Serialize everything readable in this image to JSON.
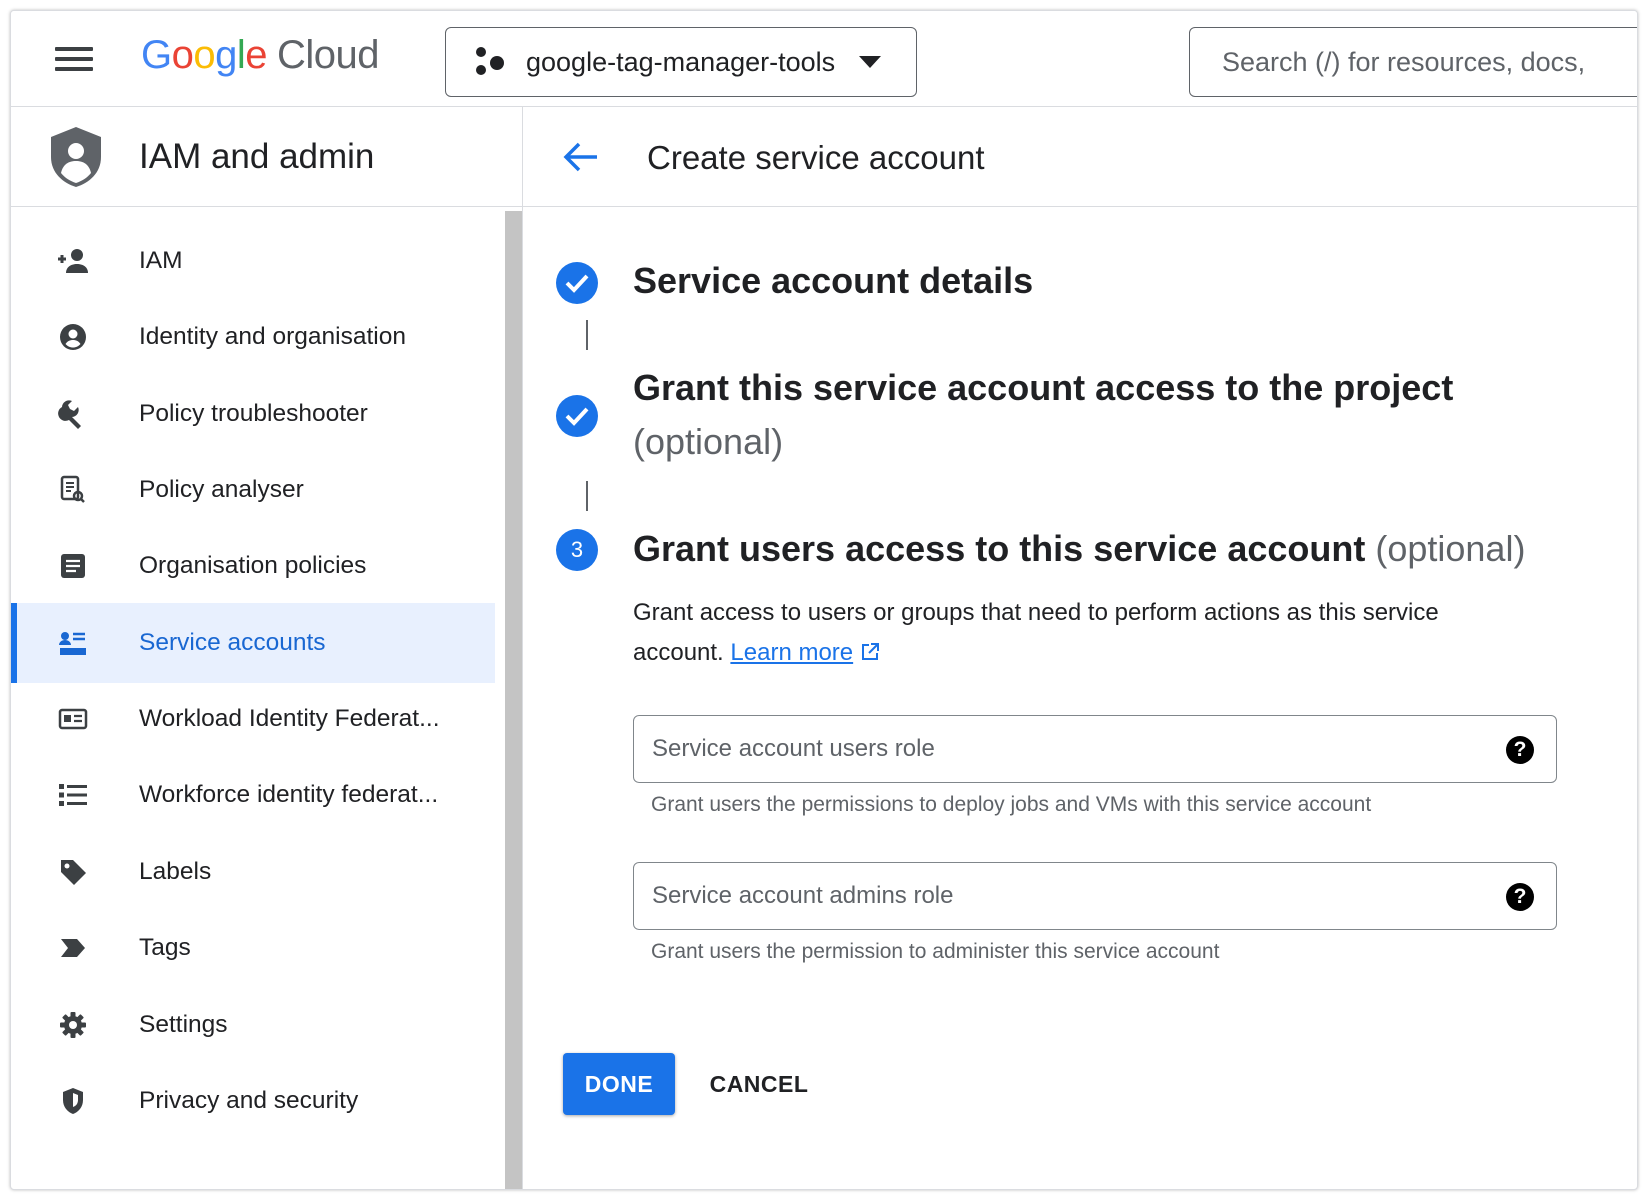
{
  "header": {
    "logo_google": [
      "G",
      "o",
      "o",
      "g",
      "l",
      "e"
    ],
    "logo_cloud": "Cloud",
    "project_name": "google-tag-manager-tools",
    "search_placeholder": "Search (/) for resources, docs,"
  },
  "sidebar": {
    "title": "IAM and admin",
    "items": [
      {
        "label": "IAM",
        "icon": "add-person-icon"
      },
      {
        "label": "Identity and organisation",
        "icon": "account-circle-icon"
      },
      {
        "label": "Policy troubleshooter",
        "icon": "wrench-icon"
      },
      {
        "label": "Policy analyser",
        "icon": "document-search-icon"
      },
      {
        "label": "Organisation policies",
        "icon": "list-document-icon"
      },
      {
        "label": "Service accounts",
        "icon": "service-account-icon",
        "active": true
      },
      {
        "label": "Workload Identity Federat...",
        "icon": "id-card-icon"
      },
      {
        "label": "Workforce identity federat...",
        "icon": "bulleted-list-icon"
      },
      {
        "label": "Labels",
        "icon": "label-icon"
      },
      {
        "label": "Tags",
        "icon": "tag-arrow-icon"
      },
      {
        "label": "Settings",
        "icon": "gear-icon"
      },
      {
        "label": "Privacy and security",
        "icon": "shield-icon"
      }
    ]
  },
  "main": {
    "page_title": "Create service account",
    "steps": [
      {
        "title": "Service account details",
        "state": "done"
      },
      {
        "title": "Grant this service account access to the project",
        "optional": "(optional)",
        "state": "done"
      },
      {
        "number": "3",
        "title": "Grant users access to this service account",
        "optional": "(optional)",
        "state": "active"
      }
    ],
    "description": "Grant access to users or groups that need to perform actions as this service account.",
    "learn_more": "Learn more",
    "fields": [
      {
        "placeholder": "Service account users role",
        "hint": "Grant users the permissions to deploy jobs and VMs with this service account"
      },
      {
        "placeholder": "Service account admins role",
        "hint": "Grant users the permission to administer this service account"
      }
    ],
    "help_glyph": "?",
    "done_label": "DONE",
    "cancel_label": "CANCEL"
  },
  "colors": {
    "accent": "#1a73e8",
    "active_bg": "#e8f0fe",
    "text": "#202124",
    "muted": "#5f6368"
  }
}
